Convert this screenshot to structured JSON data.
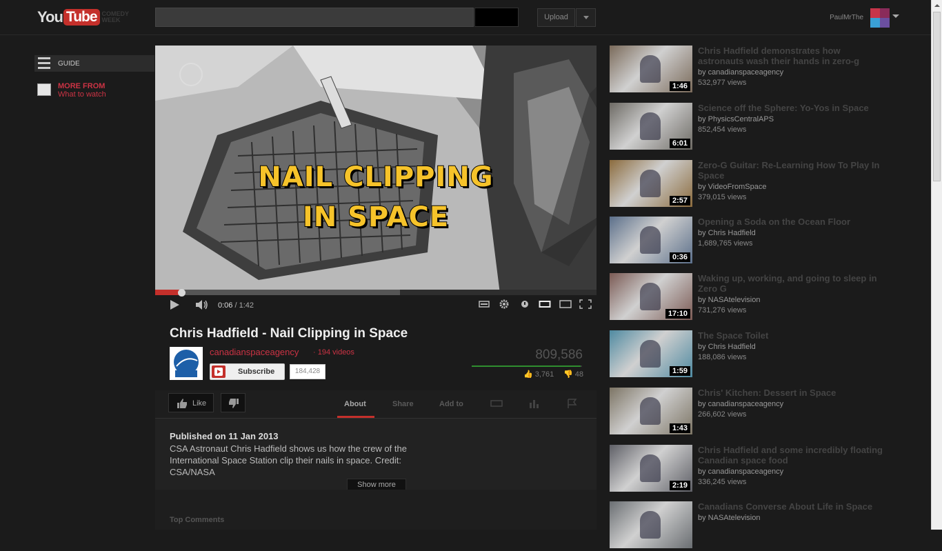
{
  "header": {
    "logo_you": "You",
    "logo_tube": "Tube",
    "logo_sub": "COMEDY WEEK",
    "upload_label": "Upload",
    "username": "PaulMrThe"
  },
  "guide": {
    "label": "GUIDE",
    "more_from_title": "MORE FROM",
    "more_from_sub": "What to watch"
  },
  "player": {
    "overlay_line1": "NAIL CLIPPING",
    "overlay_line2": "IN SPACE",
    "current_time": "0:06",
    "duration": "1:42",
    "played_fraction": 0.059,
    "buffered_fraction": 0.555,
    "colors": {
      "accent": "#c4302b",
      "overlay_text": "#f6c32a"
    }
  },
  "video": {
    "title": "Chris Hadfield - Nail Clipping in Space",
    "channel": "canadianspaceagency",
    "video_count": "· 194 videos",
    "subscribe_label": "Subscribe",
    "subscriber_count": "184,428",
    "views": "809,586",
    "likes": "3,761",
    "dislikes": "48",
    "like_ratio": 0.987,
    "like_label": "Like"
  },
  "tabs": {
    "about": "About",
    "share": "Share",
    "add_to": "Add to"
  },
  "description": {
    "published": "Published on 11 Jan 2013",
    "text": "CSA Astronaut Chris Hadfield shows us how the crew of the International Space Station clip their nails in space. Credit: CSA/NASA",
    "show_more": "Show more"
  },
  "comments": {
    "title": "Top Comments"
  },
  "related": [
    {
      "title": "Chris Hadfield demonstrates how astronauts wash their hands in zero-g",
      "channel": "by canadianspaceagency",
      "views": "532,977 views",
      "duration": "1:46",
      "thumb_color": "#7a6a5a"
    },
    {
      "title": "Science off the Sphere: Yo-Yos in Space",
      "channel": "by PhysicsCentralAPS",
      "views": "852,454 views",
      "duration": "6:01",
      "thumb_color": "#6d6a64"
    },
    {
      "title": "Zero-G Guitar: Re-Learning How To Play In Space",
      "channel": "by VideoFromSpace",
      "views": "379,015 views",
      "duration": "2:57",
      "thumb_color": "#8b6b3d"
    },
    {
      "title": "Opening a Soda on the Ocean Floor",
      "channel": "by Chris Hadfield",
      "views": "1,689,765 views",
      "duration": "0:36",
      "thumb_color": "#5b6f8a"
    },
    {
      "title": "Waking up, working, and going to sleep in Zero G",
      "channel": "by NASAtelevision",
      "views": "731,276 views",
      "duration": "17:10",
      "thumb_color": "#7b5a54"
    },
    {
      "title": "The Space Toilet",
      "channel": "by Chris Hadfield",
      "views": "188,086 views",
      "duration": "1:59",
      "thumb_color": "#4f8aa1"
    },
    {
      "title": "Chris' Kitchen: Dessert in Space",
      "channel": "by canadianspaceagency",
      "views": "266,602 views",
      "duration": "1:43",
      "thumb_color": "#7c7464"
    },
    {
      "title": "Chris Hadfield and some incredibly floating Canadian space food",
      "channel": "by canadianspaceagency",
      "views": "336,245 views",
      "duration": "2:19",
      "thumb_color": "#5e5f66"
    },
    {
      "title": "Canadians Converse About Life in Space",
      "channel": "by NASAtelevision",
      "views": "",
      "duration": "",
      "thumb_color": "#6a6e72"
    }
  ]
}
